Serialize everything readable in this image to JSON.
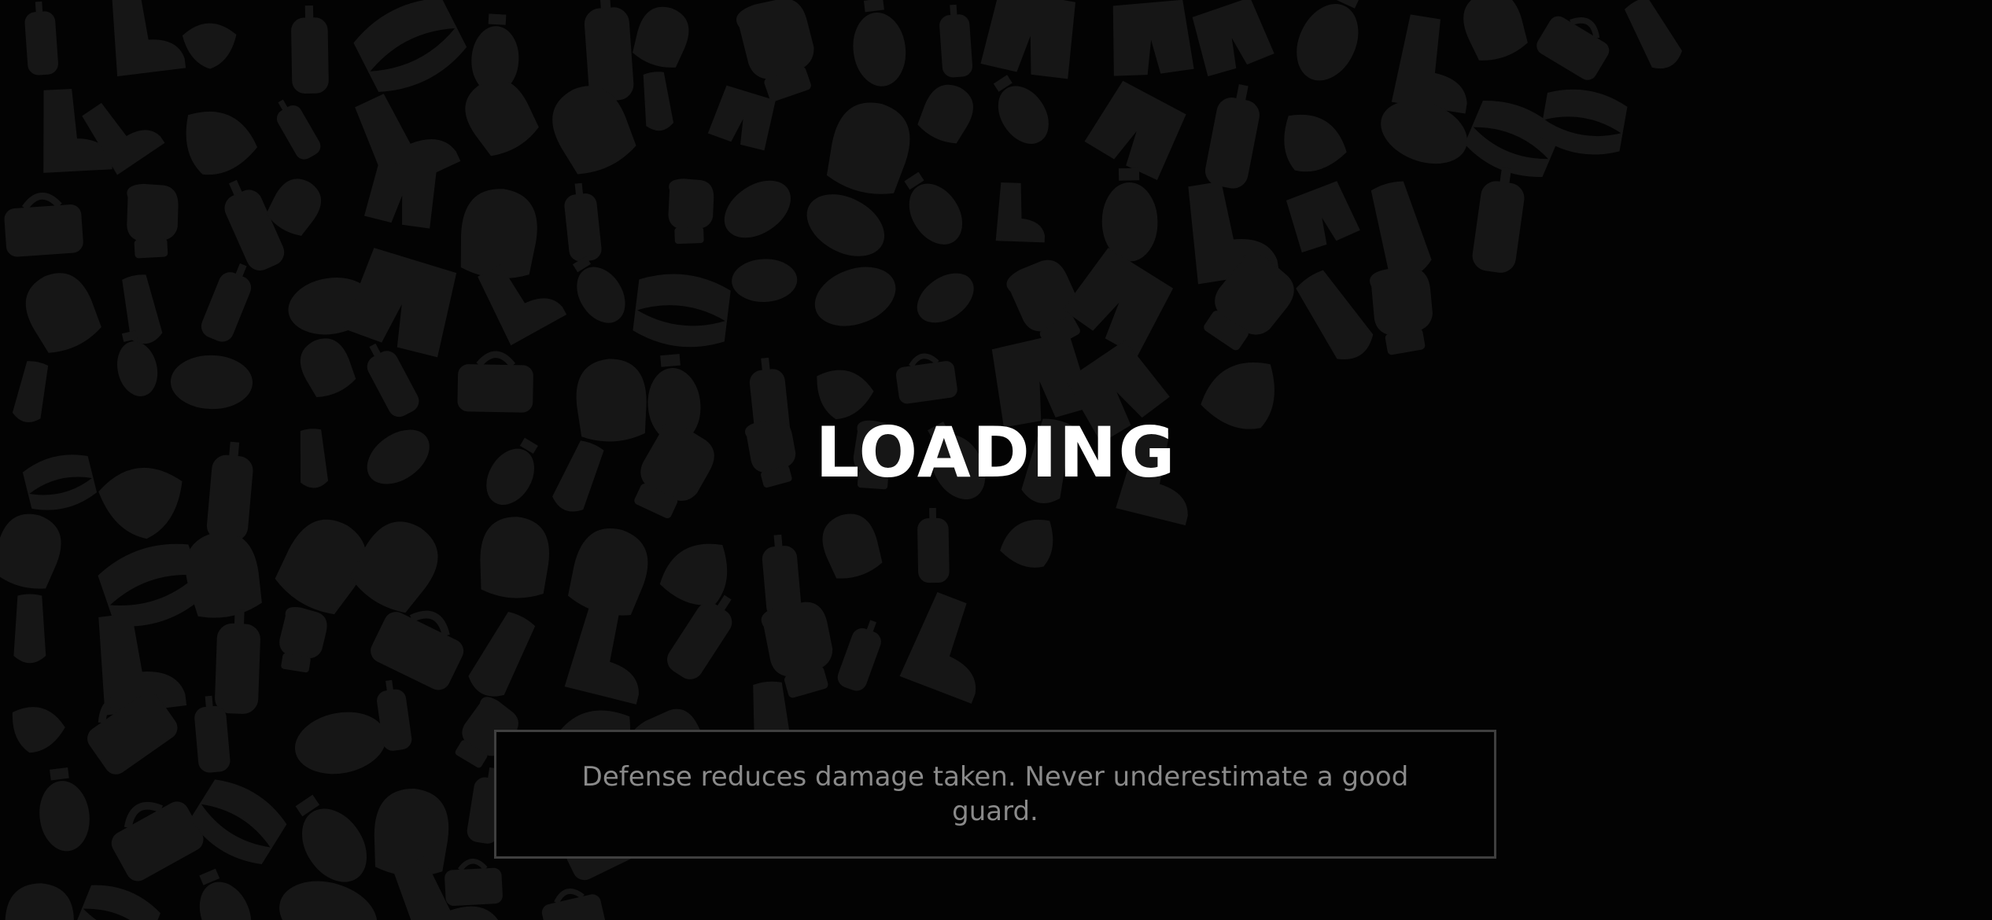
{
  "loading": {
    "title": "LOADING"
  },
  "tip": {
    "text": "Defense reduces damage taken. Never underestimate a good guard."
  },
  "colors": {
    "background": "#030303",
    "pattern": "#161616",
    "title": "#ffffff",
    "tip_text": "#8a8a8a",
    "tip_border": "#3f3f3f"
  },
  "background_pattern": {
    "icons": [
      "boxing-glove-icon",
      "punching-bag-icon",
      "speed-bag-icon",
      "headgear-icon",
      "fight-shorts-icon",
      "championship-belt-icon",
      "shin-guard-icon",
      "mouthguard-icon",
      "gym-bag-icon",
      "boxing-shoe-icon",
      "hand-wrap-icon"
    ]
  }
}
